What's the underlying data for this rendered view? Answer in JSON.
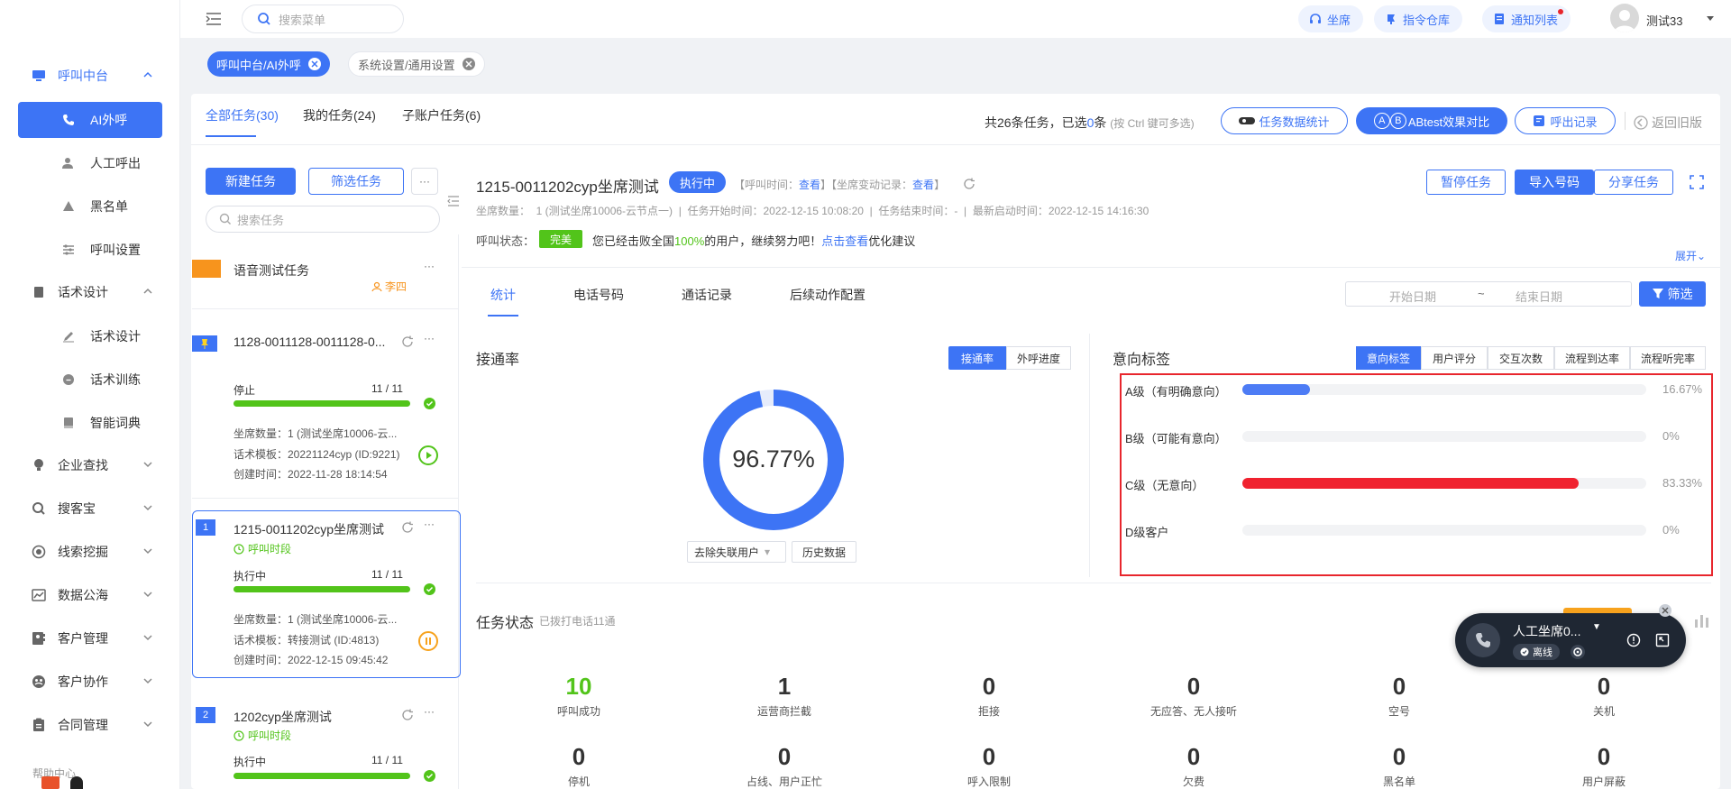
{
  "sidebar": {
    "groups": [
      {
        "label": "呼叫中台",
        "icon": "monitor-icon"
      },
      {
        "label": "话术设计",
        "icon": "book-icon"
      },
      {
        "label": "企业查找",
        "icon": "bulb-icon"
      },
      {
        "label": "搜客宝",
        "icon": "search-icon"
      },
      {
        "label": "线索挖掘",
        "icon": "target-icon"
      },
      {
        "label": "数据公海",
        "icon": "chart-icon"
      },
      {
        "label": "客户管理",
        "icon": "contacts-icon"
      },
      {
        "label": "客户协作",
        "icon": "team-icon"
      },
      {
        "label": "合同管理",
        "icon": "contract-icon"
      }
    ],
    "call_items": [
      "AI外呼",
      "人工呼出",
      "黑名单",
      "呼叫设置"
    ],
    "script_items": [
      "话术设计",
      "话术训练",
      "智能词典"
    ],
    "help": "帮助中心"
  },
  "topbar": {
    "search_placeholder": "搜索菜单",
    "seat_btn": "坐席",
    "command_btn": "指令仓库",
    "notice_btn": "通知列表",
    "user": "测试33"
  },
  "open_tabs": [
    "呼叫中台/AI外呼",
    "系统设置/通用设置"
  ],
  "task_tabs": [
    "全部任务(30)",
    "我的任务(24)",
    "子账户任务(6)"
  ],
  "summary": {
    "prefix": "共26条任务，已选",
    "count": "0",
    "suffix": "条",
    "hint": "(按 Ctrl 键可多选)"
  },
  "actions": {
    "stats": "任务数据统计",
    "abtest": "ABtest效果对比",
    "records": "呼出记录",
    "back": "返回旧版"
  },
  "left_panel": {
    "new_task": "新建任务",
    "filter_task": "筛选任务",
    "more": "···",
    "search_placeholder": "搜索任务",
    "tasks": [
      {
        "title": "语音测试任务",
        "owner": "李四"
      },
      {
        "title": "1128-0011128-0011128-0...",
        "status": "停止",
        "progress": "11 / 11",
        "progress_value": 1.0,
        "seats": "坐席数量：1 (测试坐席10006-云...",
        "template": "话术模板：20221124cyp (ID:9221)",
        "created": "创建时间：2022-11-28 18:14:54"
      },
      {
        "index": "1",
        "title": "1215-0011202cyp坐席测试",
        "sub": "呼叫时段",
        "status": "执行中",
        "progress": "11 / 11",
        "progress_value": 1.0,
        "seats": "坐席数量：1 (测试坐席10006-云...",
        "template": "话术模板：转接测试 (ID:4813)",
        "created": "创建时间：2022-12-15 09:45:42"
      },
      {
        "index": "2",
        "title": "1202cyp坐席测试",
        "sub": "呼叫时段",
        "status": "执行中",
        "progress": "11 / 11",
        "progress_value": 1.0
      }
    ]
  },
  "detail": {
    "title": "1215-0011202cyp坐席测试",
    "badge": "执行中",
    "call_time_label": "【呼叫时间：",
    "view1": "查看",
    "mid": "】【坐席变动记录：",
    "view2": "查看",
    "end": "】",
    "pause": "暂停任务",
    "import": "导入号码",
    "share": "分享任务",
    "meta": "坐席数量：  1 (测试坐席10006-云节点一)  |  任务开始时间：2022-12-15 10:08:20  |  任务结束时间：-  |  最新启动时间：2022-12-15 14:16:30",
    "call_state_label": "呼叫状态：",
    "call_state_badge": "完美",
    "msg1": "您已经击败全国",
    "msg_pct": "100%",
    "msg2": "的用户，继续努力吧！",
    "msg_link": "点击查看",
    "msg3": "优化建议",
    "expand": "展开",
    "tabs": [
      "统计",
      "电话号码",
      "通话记录",
      "后续动作配置"
    ],
    "start_date": "开始日期",
    "tilde": "~",
    "end_date": "结束日期",
    "filter": "筛选"
  },
  "connect": {
    "title": "接通率",
    "seg": [
      "接通率",
      "外呼进度"
    ],
    "value": "96.77%",
    "value_num": 96.77,
    "dropdown": "去除失联用户",
    "history": "历史数据"
  },
  "intent": {
    "title": "意向标签",
    "seg": [
      "意向标签",
      "用户评分",
      "交互次数",
      "流程到达率",
      "流程听完率"
    ],
    "rows": [
      {
        "label": "A级（有明确意向）",
        "pct": "16.67%",
        "value": 16.67,
        "color": "#4d7cf5"
      },
      {
        "label": "B级（可能有意向）",
        "pct": "0%",
        "value": 0,
        "color": "#4d7cf5"
      },
      {
        "label": "C级（无意向）",
        "pct": "83.33%",
        "value": 83.33,
        "color": "#f0222f"
      },
      {
        "label": "D级客户",
        "pct": "0%",
        "value": 0,
        "color": "#4d7cf5"
      }
    ]
  },
  "task_status": {
    "title": "任务状态",
    "sub": "已拨打电话11通",
    "row1": [
      {
        "n": "10",
        "l": "呼叫成功",
        "green": true
      },
      {
        "n": "1",
        "l": "运营商拦截"
      },
      {
        "n": "0",
        "l": "拒接"
      },
      {
        "n": "0",
        "l": "无应答、无人接听"
      },
      {
        "n": "0",
        "l": "空号"
      },
      {
        "n": "0",
        "l": "关机"
      }
    ],
    "row2": [
      {
        "n": "0",
        "l": "停机"
      },
      {
        "n": "0",
        "l": "占线、用户正忙"
      },
      {
        "n": "0",
        "l": "呼入限制"
      },
      {
        "n": "0",
        "l": "欠费"
      },
      {
        "n": "0",
        "l": "黑名单"
      },
      {
        "n": "0",
        "l": "用户屏蔽"
      }
    ]
  },
  "softphone": {
    "name": "人工坐席0...",
    "status": "离线"
  },
  "colors": {
    "primary": "#3d74f5",
    "green": "#52c41a",
    "red": "#f0222f",
    "alert": "#e8262d",
    "orange": "#f7941d"
  }
}
